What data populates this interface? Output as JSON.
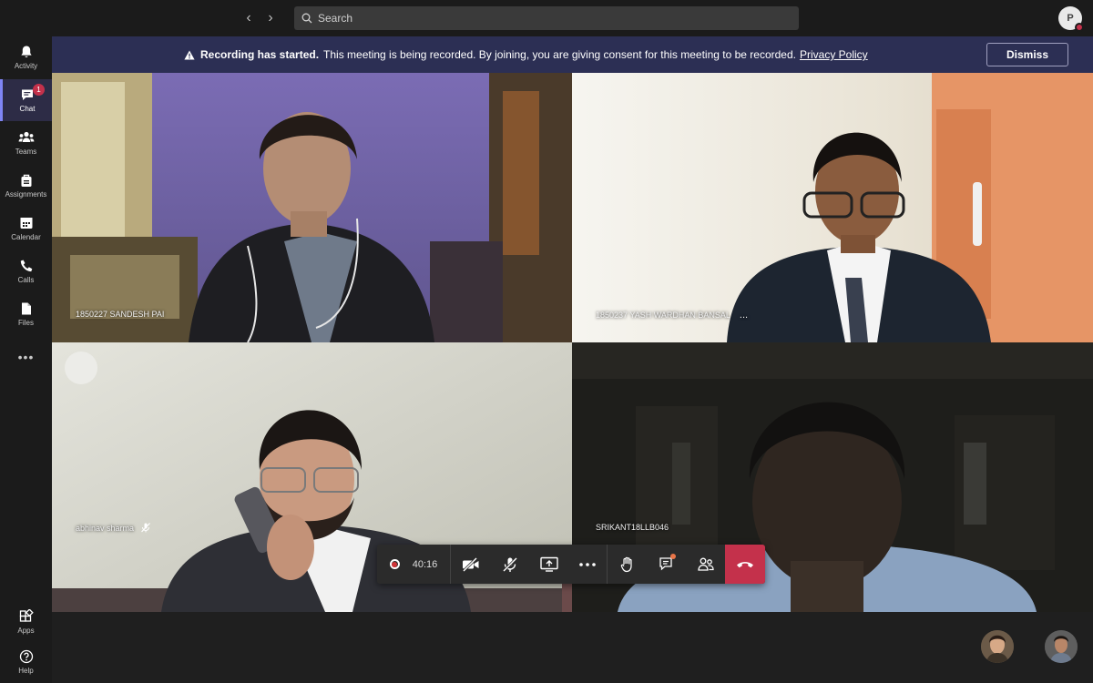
{
  "search": {
    "placeholder": "Search"
  },
  "user": {
    "initial": "P"
  },
  "rail": [
    {
      "label": "Activity",
      "icon": "bell-icon"
    },
    {
      "label": "Chat",
      "icon": "chat-icon",
      "badge": "1",
      "active": true
    },
    {
      "label": "Teams",
      "icon": "teams-icon"
    },
    {
      "label": "Assignments",
      "icon": "assignments-icon"
    },
    {
      "label": "Calendar",
      "icon": "calendar-icon"
    },
    {
      "label": "Calls",
      "icon": "phone-icon"
    },
    {
      "label": "Files",
      "icon": "files-icon"
    },
    {
      "label": "Apps",
      "icon": "apps-icon"
    },
    {
      "label": "Help",
      "icon": "help-icon"
    }
  ],
  "banner": {
    "title": "Recording has started.",
    "message": "This meeting is being recorded. By joining, you are giving consent for this meeting to be recorded.",
    "link": "Privacy Policy",
    "dismiss": "Dismiss"
  },
  "participants": [
    {
      "name": "1850227 SANDESH PAI"
    },
    {
      "name": "1850237 YASH WARDHAN BANSAL",
      "extra": "..."
    },
    {
      "name": "abhinav sharma",
      "muted": true
    },
    {
      "name": "SRIKANT18LLB046"
    }
  ],
  "controls": {
    "timer": "40:16"
  },
  "colors": {
    "banner": "#2c2f54",
    "accent": "#7f85f5",
    "hangup": "#c4314b"
  }
}
